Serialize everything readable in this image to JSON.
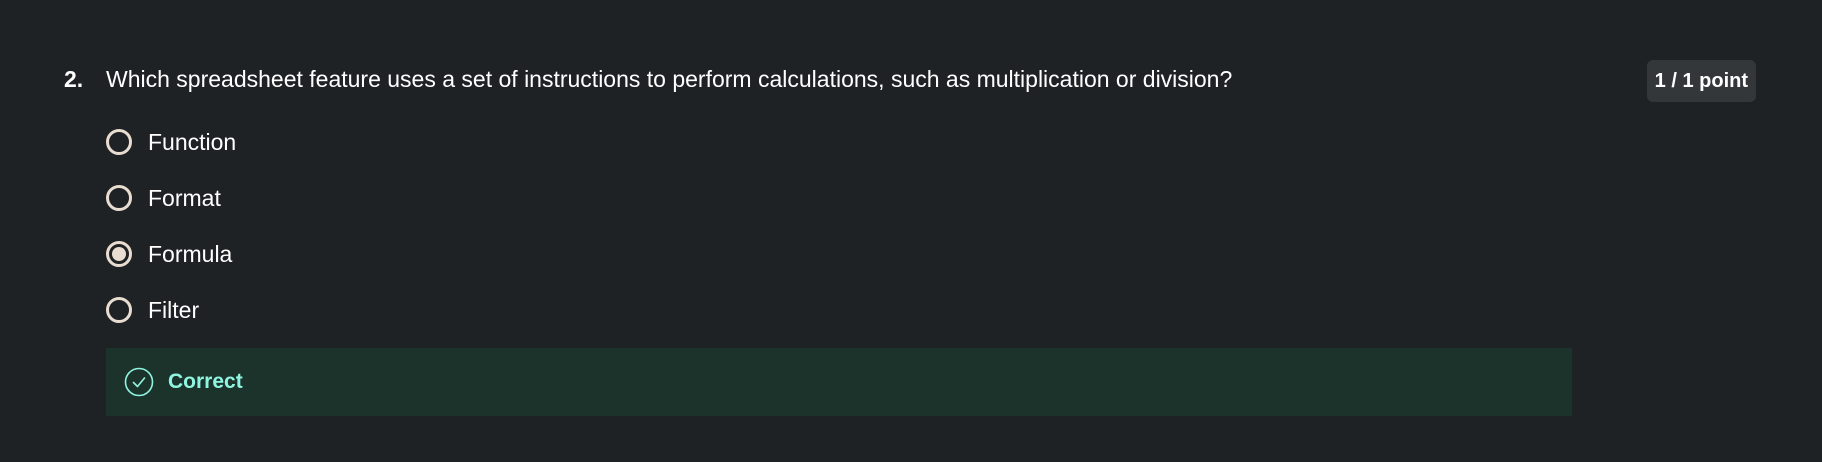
{
  "question": {
    "number": "2.",
    "text": "Which spreadsheet feature uses a set of instructions to perform calculations, such as multiplication or division?",
    "points": "1 / 1 point",
    "options": [
      {
        "label": "Function",
        "selected": false
      },
      {
        "label": "Format",
        "selected": false
      },
      {
        "label": "Formula",
        "selected": true
      },
      {
        "label": "Filter",
        "selected": false
      }
    ],
    "feedback": {
      "label": "Correct",
      "icon": "check-circle-icon"
    }
  },
  "colors": {
    "background": "#1f2224",
    "badge": "#33373a",
    "feedback_bg": "#1c332c",
    "correct_text": "#8ff5e0",
    "radio": "#e8ddd0"
  }
}
